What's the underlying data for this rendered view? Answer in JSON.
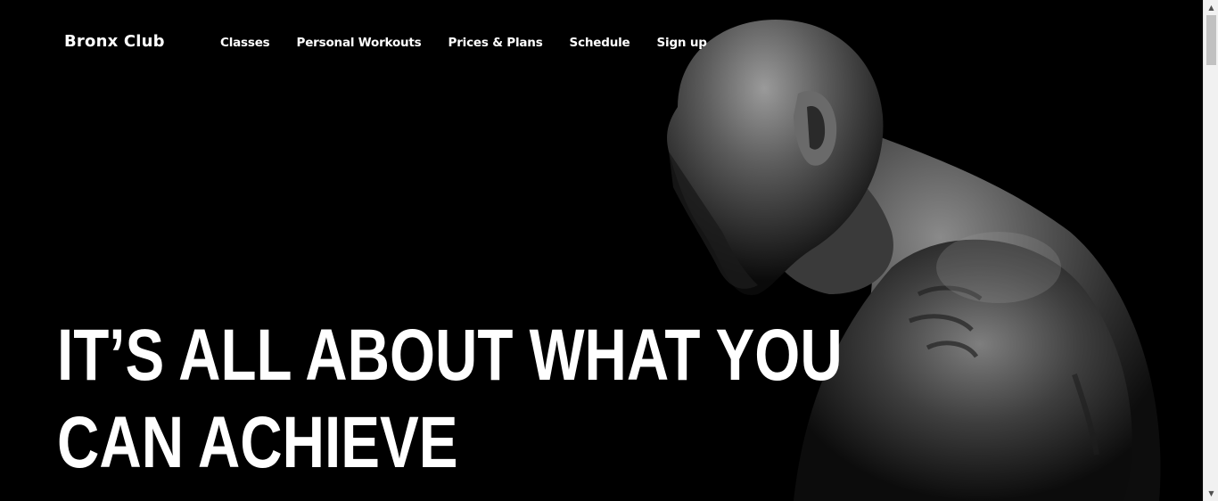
{
  "brand": {
    "name": "Bronx Club"
  },
  "nav": {
    "items": [
      {
        "label": "Classes"
      },
      {
        "label": "Personal Workouts"
      },
      {
        "label": "Prices & Plans"
      },
      {
        "label": "Schedule"
      },
      {
        "label": "Sign up"
      }
    ]
  },
  "hero": {
    "headline_line1": "IT’S ALL ABOUT WHAT YOU",
    "headline_line2": "CAN ACHIEVE",
    "image": "athlete-photo"
  },
  "colors": {
    "background": "#000000",
    "text": "#ffffff"
  },
  "scrollbar": {
    "up_icon": "scroll-up-arrow-icon",
    "down_icon": "scroll-down-arrow-icon"
  }
}
